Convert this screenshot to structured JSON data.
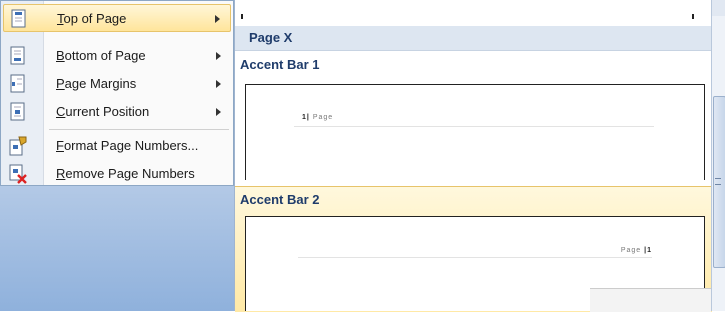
{
  "menu": {
    "items": [
      {
        "accel": "T",
        "rest": "op of Page",
        "icon": "page-top-icon",
        "submenu": true,
        "highlighted": true
      },
      {
        "accel": "B",
        "rest": "ottom of Page",
        "icon": "page-bottom-icon",
        "submenu": true,
        "highlighted": false
      },
      {
        "accel": "P",
        "rest": "age Margins",
        "icon": "page-margins-icon",
        "submenu": true,
        "highlighted": false
      },
      {
        "accel": "C",
        "rest": "urrent Position",
        "icon": "current-position-icon",
        "submenu": true,
        "highlighted": false
      },
      {
        "accel": "F",
        "rest": "ormat Page Numbers...",
        "icon": "format-page-numbers-icon",
        "submenu": false,
        "highlighted": false
      },
      {
        "accel": "R",
        "rest": "emove Page Numbers",
        "icon": "remove-page-numbers-icon",
        "submenu": false,
        "highlighted": false
      }
    ]
  },
  "gallery": {
    "group_header": "Page X",
    "items": [
      {
        "label": "Accent Bar 1",
        "sample_num": "1",
        "sample_text": "Page"
      },
      {
        "label": "Accent Bar 2",
        "sample_num": "1",
        "sample_text": "Page"
      }
    ]
  },
  "colors": {
    "highlight": "#ffe59b",
    "header_bg": "#dde6f1",
    "header_text": "#1f3c6b"
  }
}
